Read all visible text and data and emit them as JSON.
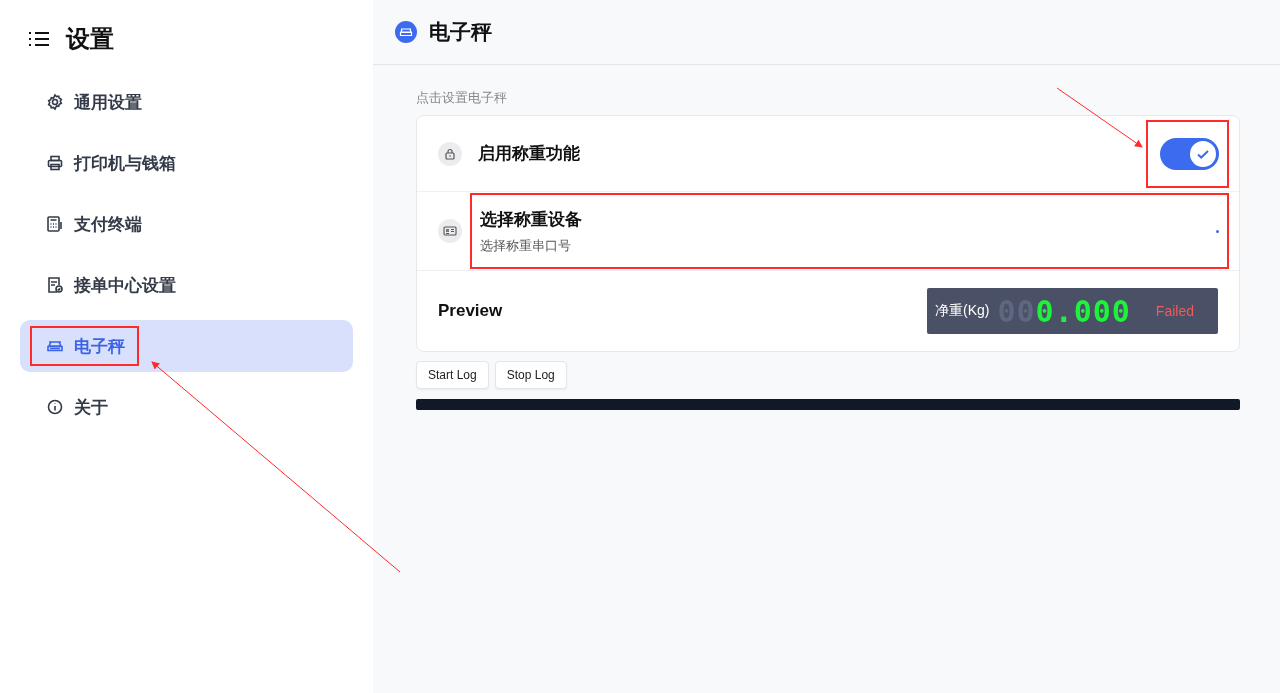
{
  "sidebar": {
    "title": "设置",
    "items": [
      {
        "label": "通用设置",
        "selected": false,
        "annotated": false
      },
      {
        "label": "打印机与钱箱",
        "selected": false,
        "annotated": false
      },
      {
        "label": "支付终端",
        "selected": false,
        "annotated": false
      },
      {
        "label": "接单中心设置",
        "selected": false,
        "annotated": false
      },
      {
        "label": "电子秤",
        "selected": true,
        "annotated": true
      },
      {
        "label": "关于",
        "selected": false,
        "annotated": false
      }
    ]
  },
  "header": {
    "title": "电子秤"
  },
  "section_hint": "点击设置电子秤",
  "settings": [
    {
      "kind": "toggle",
      "title": "启用称重功能",
      "on": true,
      "annotated": true
    },
    {
      "kind": "select",
      "title": "选择称重设备",
      "subtitle": "选择称重串口号",
      "annotated": true
    },
    {
      "kind": "preview",
      "title": "Preview",
      "display": {
        "label": "净重(Kg)",
        "dim_digits": "00",
        "value": "0.000",
        "status": "Failed"
      }
    }
  ],
  "buttons": [
    "Start Log",
    "Stop Log"
  ]
}
